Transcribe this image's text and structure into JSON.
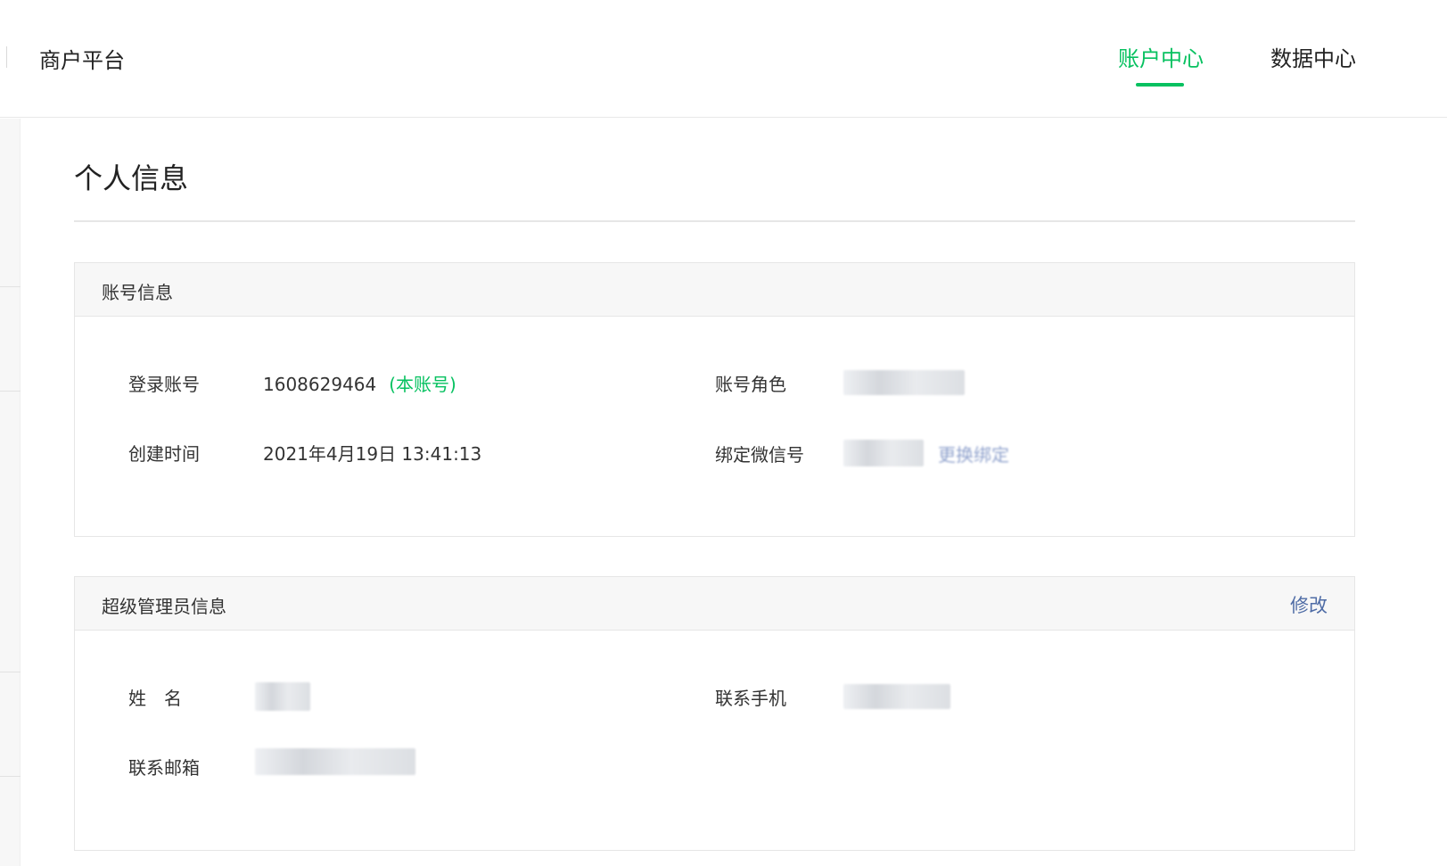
{
  "header": {
    "brand": "商户平台",
    "tabs": [
      {
        "label": "账户中心",
        "active": true
      },
      {
        "label": "数据中心",
        "active": false
      }
    ]
  },
  "page": {
    "title": "个人信息"
  },
  "account_panel": {
    "title": "账号信息",
    "login_account_label": "登录账号",
    "login_account_value": "1608629464",
    "login_account_tag": "(本账号)",
    "created_label": "创建时间",
    "created_value": "2021年4月19日 13:41:13",
    "role_label": "账号角色",
    "wechat_label": "绑定微信号",
    "wechat_action": "更换绑定"
  },
  "admin_panel": {
    "title": "超级管理员信息",
    "edit_label": "修改",
    "name_label": "姓　名",
    "phone_label": "联系手机",
    "email_label": "联系邮箱"
  },
  "colors": {
    "accent": "#07c160",
    "link": "#4f6ca6",
    "panel_header_bg": "#f7f7f7"
  }
}
